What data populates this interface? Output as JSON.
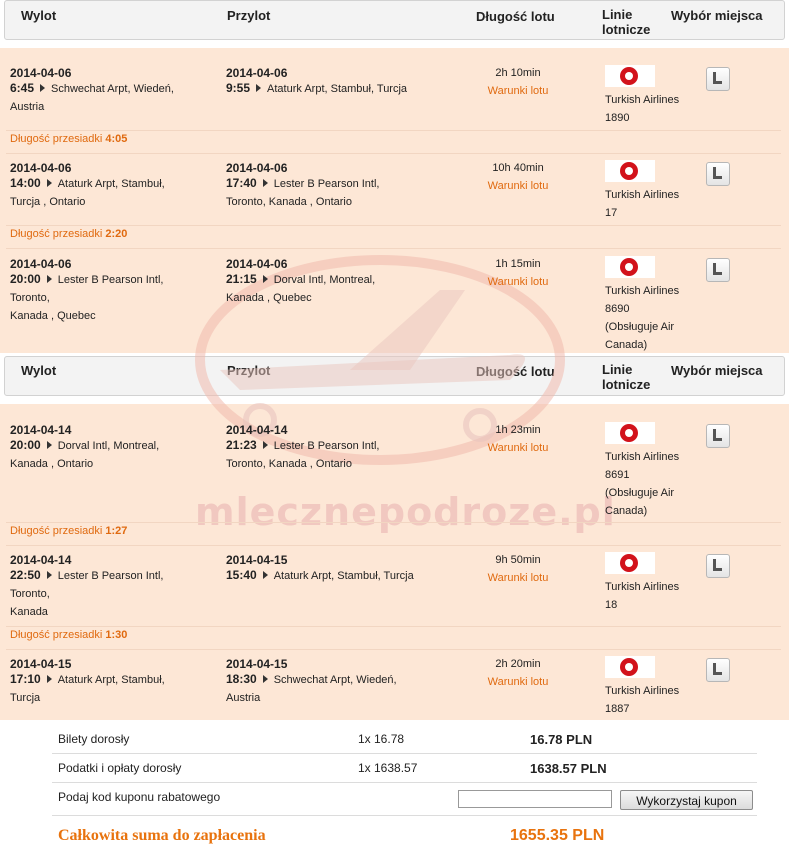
{
  "header": {
    "departure": "Wylot",
    "arrival": "Przylot",
    "duration": "Długość lotu",
    "airline_line1": "Linie",
    "airline_line2": "lotnicze",
    "seat_choice": "Wybór miejsca"
  },
  "conditions_label": "Warunki lotu",
  "layover_label": "Długość przesiadki",
  "outbound": {
    "segments": [
      {
        "dep_date": "2014-04-06",
        "dep_time": "6:45",
        "dep_place": [
          "Schwechat Arpt, Wiedeń,",
          "Austria"
        ],
        "arr_date": "2014-04-06",
        "arr_time": "9:55",
        "arr_place": [
          "Ataturk Arpt, Stambuł, Turcja"
        ],
        "duration": "2h 10min",
        "airline": "Turkish Airlines",
        "flight": "1890",
        "operated": []
      },
      {
        "dep_date": "2014-04-06",
        "dep_time": "14:00",
        "dep_place": [
          "Ataturk Arpt, Stambuł,",
          "Turcja , Ontario"
        ],
        "arr_date": "2014-04-06",
        "arr_time": "17:40",
        "arr_place": [
          "Lester B Pearson Intl,",
          "Toronto, Kanada , Ontario"
        ],
        "duration": "10h 40min",
        "airline": "Turkish Airlines",
        "flight": "17",
        "operated": []
      },
      {
        "dep_date": "2014-04-06",
        "dep_time": "20:00",
        "dep_place": [
          "Lester B Pearson Intl,",
          "Toronto,",
          "Kanada , Quebec"
        ],
        "arr_date": "2014-04-06",
        "arr_time": "21:15",
        "arr_place": [
          "Dorval Intl, Montreal,",
          "Kanada , Quebec"
        ],
        "duration": "1h 15min",
        "airline": "Turkish Airlines",
        "flight": "8690",
        "operated": [
          "(Obsługuje Air",
          "Canada)"
        ]
      }
    ],
    "layovers": [
      "4:05",
      "2:20"
    ]
  },
  "return": {
    "segments": [
      {
        "dep_date": "2014-04-14",
        "dep_time": "20:00",
        "dep_place": [
          "Dorval Intl, Montreal,",
          "Kanada , Ontario"
        ],
        "arr_date": "2014-04-14",
        "arr_time": "21:23",
        "arr_place": [
          "Lester B Pearson Intl,",
          "Toronto, Kanada , Ontario"
        ],
        "duration": "1h 23min",
        "airline": "Turkish Airlines",
        "flight": "8691",
        "operated": [
          "(Obsługuje Air",
          "Canada)"
        ]
      },
      {
        "dep_date": "2014-04-14",
        "dep_time": "22:50",
        "dep_place": [
          "Lester B Pearson Intl,",
          "Toronto,",
          "Kanada"
        ],
        "arr_date": "2014-04-15",
        "arr_time": "15:40",
        "arr_place": [
          "Ataturk Arpt, Stambuł, Turcja"
        ],
        "duration": "9h 50min",
        "airline": "Turkish Airlines",
        "flight": "18",
        "operated": []
      },
      {
        "dep_date": "2014-04-15",
        "dep_time": "17:10",
        "dep_place": [
          "Ataturk Arpt, Stambuł,",
          "Turcja"
        ],
        "arr_date": "2014-04-15",
        "arr_time": "18:30",
        "arr_place": [
          "Schwechat Arpt, Wiedeń,",
          "Austria"
        ],
        "duration": "2h 20min",
        "airline": "Turkish Airlines",
        "flight": "1887",
        "operated": []
      }
    ],
    "layovers": [
      "1:27",
      "1:30"
    ]
  },
  "summary": {
    "tickets_label": "Bilety dorosły",
    "tickets_qty": "1x 16.78",
    "tickets_total": "16.78 PLN",
    "taxes_label": "Podatki i opłaty dorosły",
    "taxes_qty": "1x 1638.57",
    "taxes_total": "1638.57 PLN",
    "coupon_label": "Podaj kod kuponu rabatowego",
    "coupon_value": "",
    "coupon_button": "Wykorzystaj kupon",
    "total_label": "Całkowita suma do zapłacenia",
    "total_value": "1655.35 PLN"
  },
  "watermark": "mlecznepodroze.pl",
  "colors": {
    "accent": "#e06a10",
    "band": "#fde7d6",
    "turkish_red": "#d2121b"
  },
  "icons": {
    "airline_logo": "turkish-airlines-logo",
    "seat": "seat-icon",
    "arrow": "arrow-right-icon"
  }
}
